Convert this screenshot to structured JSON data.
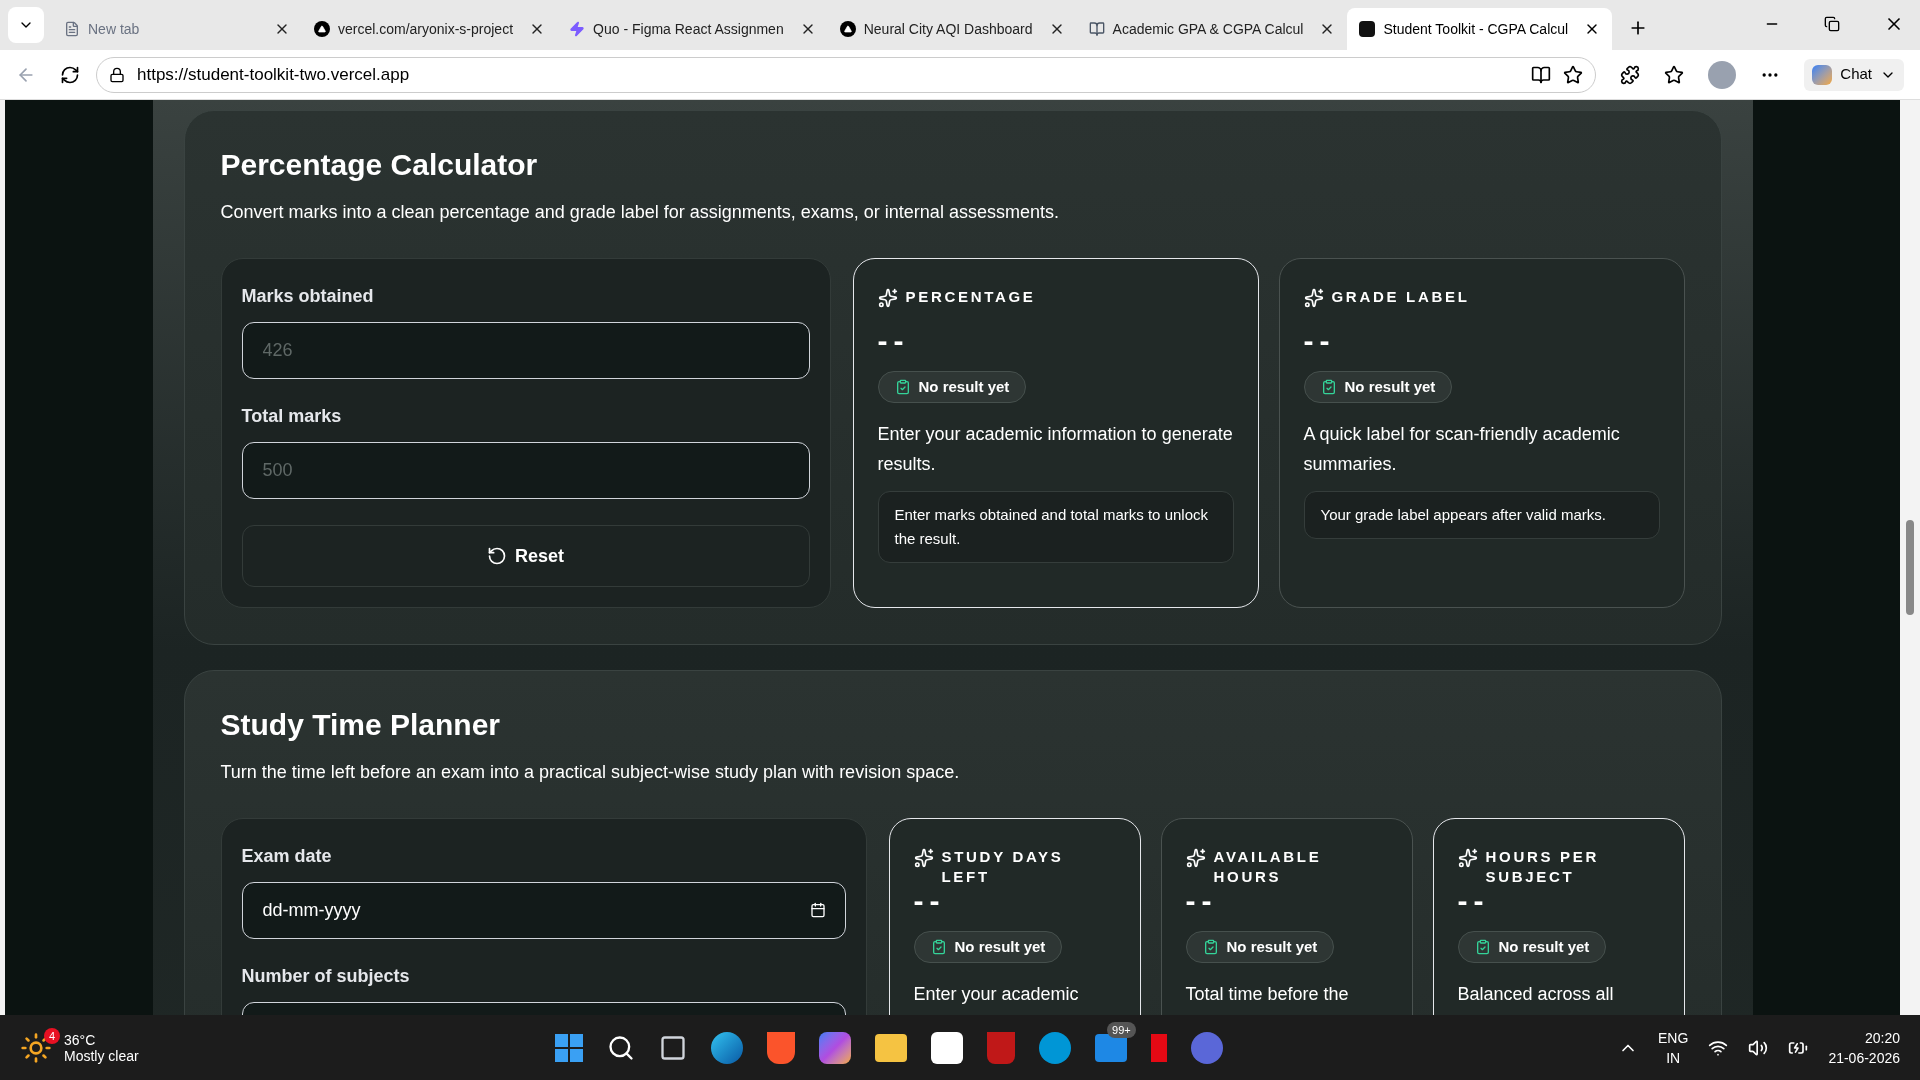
{
  "browser": {
    "tabs": [
      {
        "title": "New tab",
        "selected": false
      },
      {
        "title": "vercel.com/aryonix-s-project",
        "selected": false
      },
      {
        "title": "Quo - Figma React Assignmen",
        "selected": false
      },
      {
        "title": "Neural City AQI Dashboard",
        "selected": false
      },
      {
        "title": "Academic GPA & CGPA Calcul",
        "selected": false
      },
      {
        "title": "Student Toolkit - CGPA Calcul",
        "selected": true
      }
    ],
    "url": "https://student-toolkit-two.vercel.app",
    "chat_label": "Chat"
  },
  "sections": [
    {
      "title": "Percentage Calculator",
      "description": "Convert marks into a clean percentage and grade label for assignments, exams, or internal assessments.",
      "fields": [
        {
          "label": "Marks obtained",
          "placeholder": "426",
          "kind": "number"
        },
        {
          "label": "Total marks",
          "placeholder": "500",
          "kind": "number"
        }
      ],
      "reset_label": "Reset",
      "cards": [
        {
          "label": "PERCENTAGE",
          "value": "--",
          "badge": "No result yet",
          "text": "Enter your academic information to generate results.",
          "note": "Enter marks obtained and total marks to unlock the result.",
          "highlighted": true
        },
        {
          "label": "GRADE LABEL",
          "value": "--",
          "badge": "No result yet",
          "text": "A quick label for scan-friendly academic summaries.",
          "note": "Your grade label appears after valid marks.",
          "highlighted": false
        }
      ]
    },
    {
      "title": "Study Time Planner",
      "description": "Turn the time left before an exam into a practical subject-wise study plan with revision space.",
      "fields": [
        {
          "label": "Exam date",
          "placeholder": "dd-mm-yyyy",
          "kind": "date"
        },
        {
          "label": "Number of subjects",
          "kind": "number"
        }
      ],
      "cards": [
        {
          "label": "STUDY DAYS LEFT",
          "value": "--",
          "badge": "No result yet",
          "text": "Enter your academic",
          "highlighted": true
        },
        {
          "label": "AVAILABLE HOURS",
          "value": "--",
          "badge": "No result yet",
          "text": "Total time before the",
          "highlighted": false
        },
        {
          "label": "HOURS PER SUBJECT",
          "value": "--",
          "badge": "No result yet",
          "text": "Balanced across all",
          "highlighted": true
        }
      ]
    }
  ],
  "taskbar": {
    "weather_temp": "36°C",
    "weather_text": "Mostly clear",
    "weather_badge": "4",
    "mail_badge": "99+",
    "language": "ENG",
    "region": "IN",
    "time": "20:20",
    "date": "21-06-2026"
  }
}
